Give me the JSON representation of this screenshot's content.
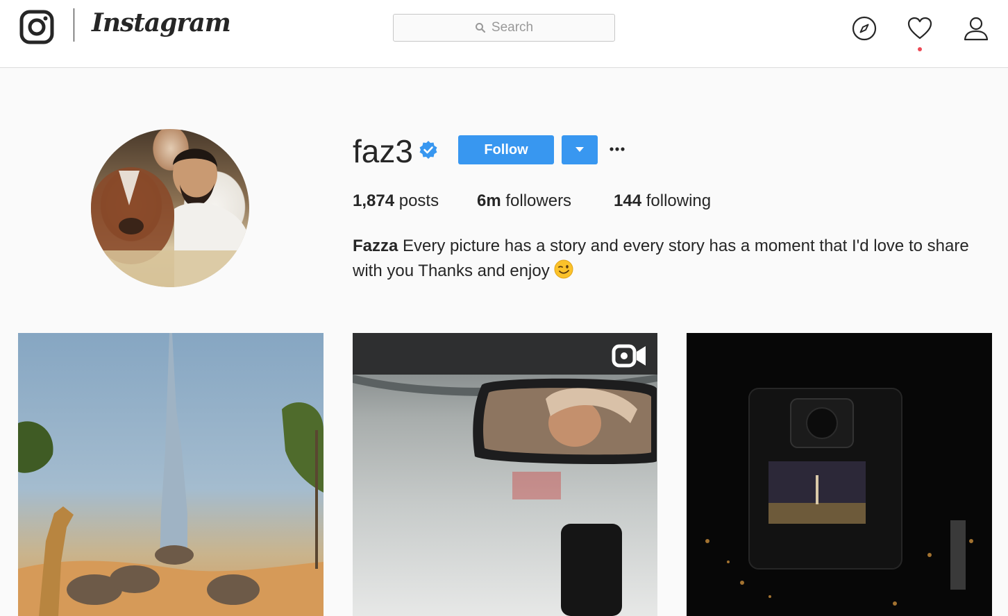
{
  "app": {
    "wordmark": "Instagram",
    "search": {
      "placeholder": "Search"
    }
  },
  "nav_icons": [
    "explore-compass-icon",
    "activity-heart-icon",
    "profile-person-icon"
  ],
  "profile": {
    "username": "faz3",
    "verified": true,
    "follow_label": "Follow",
    "stats": {
      "posts_count": "1,874",
      "posts_label": "posts",
      "followers_count": "6m",
      "followers_label": "followers",
      "following_count": "144",
      "following_label": "following"
    },
    "bio": {
      "name": "Fazza",
      "text": "Every picture has a story and every story has a moment that I'd love to share with you Thanks and enjoy",
      "emoji": "winking-face"
    }
  },
  "posts": [
    {
      "type": "photo"
    },
    {
      "type": "video"
    },
    {
      "type": "photo"
    }
  ],
  "colors": {
    "accent": "#3897f0",
    "notification": "#ed4956",
    "background": "#fafafa",
    "text": "#262626"
  }
}
